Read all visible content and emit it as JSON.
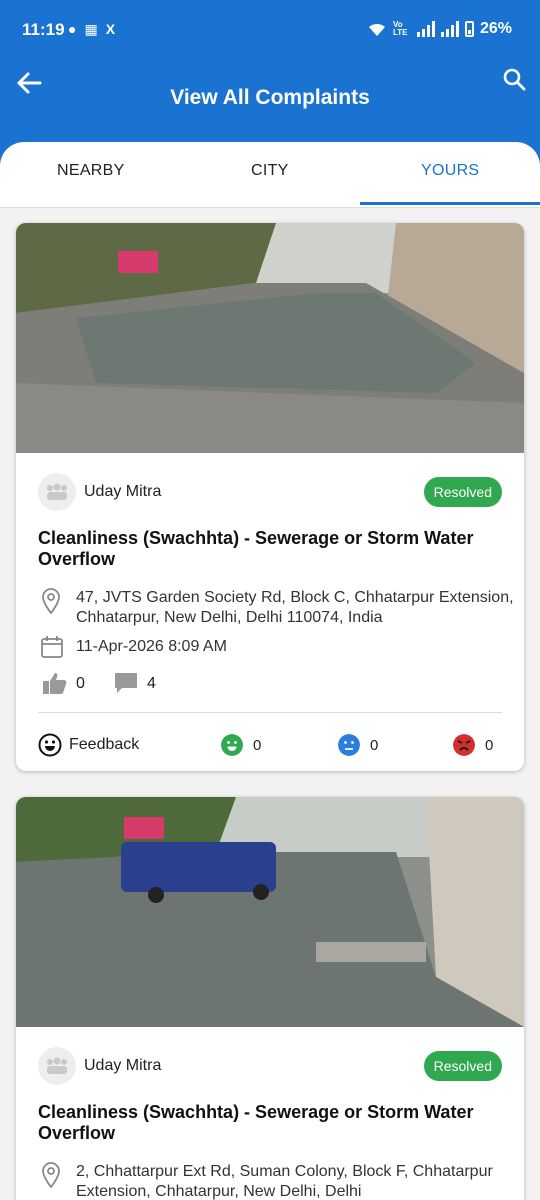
{
  "status_bar": {
    "time": "11:19",
    "battery": "26%",
    "network": "Vo LTE"
  },
  "header": {
    "title": "View All Complaints",
    "accent_color": "#1a73d0"
  },
  "tabs": [
    {
      "label": "NEARBY",
      "active": false
    },
    {
      "label": "CITY",
      "active": false
    },
    {
      "label": "YOURS",
      "active": true
    }
  ],
  "complaints": [
    {
      "user": "Uday Mitra",
      "status": "Resolved",
      "title": "Cleanliness (Swachhta) - Sewerage or Storm Water Overflow",
      "address": "47, JVTS Garden Society Rd, Block C, Chhatarpur Extension, Chhatarpur, New Delhi, Delhi 110074, India",
      "date": "11-Apr-2026 8:09 AM",
      "likes": "0",
      "comments": "4",
      "feedback_label": "Feedback",
      "feedback": {
        "happy": "0",
        "neutral": "0",
        "angry": "0"
      }
    },
    {
      "user": "Uday Mitra",
      "status": "Resolved",
      "title": "Cleanliness (Swachhta) - Sewerage or Storm Water Overflow",
      "address": "2, Chhattarpur Ext Rd, Suman Colony, Block F, Chhatarpur Extension, Chhatarpur, New Delhi, Delhi"
    }
  ]
}
